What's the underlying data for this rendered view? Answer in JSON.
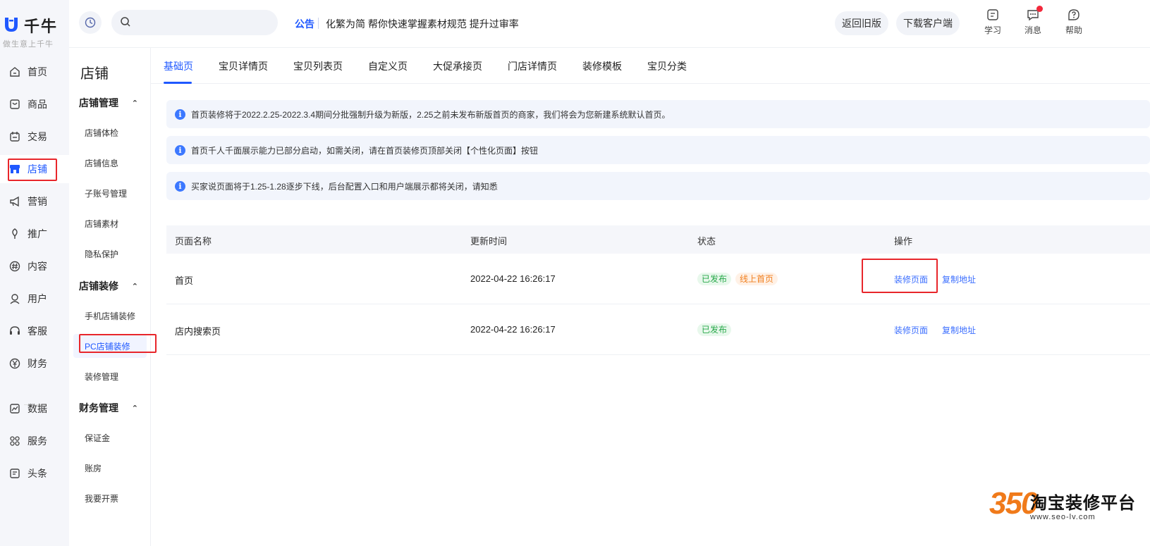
{
  "brand": {
    "name": "千牛",
    "slogan": "做生意上千牛",
    "color": "#1f58ff"
  },
  "leftnav": {
    "items": [
      {
        "label": "首页",
        "icon": "home-icon"
      },
      {
        "label": "商品",
        "icon": "goods-icon"
      },
      {
        "label": "交易",
        "icon": "trade-icon"
      },
      {
        "label": "店铺",
        "icon": "shop-icon",
        "active": true
      },
      {
        "label": "营销",
        "icon": "megaphone-icon"
      },
      {
        "label": "推广",
        "icon": "promote-icon"
      },
      {
        "label": "内容",
        "icon": "hash-icon"
      },
      {
        "label": "用户",
        "icon": "user-icon"
      },
      {
        "label": "客服",
        "icon": "headset-icon"
      },
      {
        "label": "财务",
        "icon": "yen-icon"
      },
      {
        "label": "数据",
        "icon": "chart-icon"
      },
      {
        "label": "服务",
        "icon": "apps-icon"
      },
      {
        "label": "头条",
        "icon": "news-icon"
      }
    ]
  },
  "topbar": {
    "search": {
      "placeholder": "",
      "value": ""
    },
    "notice_tag": "公告",
    "notice_text": "化繁为简 帮你快速掌握素材规范 提升过审率",
    "old_version_label": "返回旧版",
    "download_label": "下载客户端",
    "tools": [
      {
        "label": "学习",
        "icon": "learn-icon"
      },
      {
        "label": "消息",
        "icon": "message-icon",
        "has_unread": true
      },
      {
        "label": "帮助",
        "icon": "help-icon"
      }
    ]
  },
  "subnav": {
    "title": "店铺",
    "groups": [
      {
        "label": "店铺管理",
        "items": [
          "店铺体检",
          "店铺信息",
          "子账号管理",
          "店铺素材",
          "隐私保护"
        ]
      },
      {
        "label": "店铺装修",
        "items": [
          "手机店铺装修",
          "PC店铺装修",
          "装修管理"
        ]
      },
      {
        "label": "财务管理",
        "items": [
          "保证金",
          "账房",
          "我要开票"
        ]
      }
    ],
    "active_item": "PC店铺装修"
  },
  "tabs": [
    "基础页",
    "宝贝详情页",
    "宝贝列表页",
    "自定义页",
    "大促承接页",
    "门店详情页",
    "装修模板",
    "宝贝分类"
  ],
  "notices": [
    "首页装修将于2022.2.25-2022.3.4期间分批强制升级为新版，2.25之前未发布新版首页的商家，我们将会为您新建系统默认首页。",
    "首页千人千面展示能力已部分启动，如需关闭，请在首页装修页顶部关闭【个性化页面】按钮",
    "买家说页面将于1.25-1.28逐步下线，后台配置入口和用户端展示都将关闭，请知悉"
  ],
  "table": {
    "columns": [
      "页面名称",
      "更新时间",
      "状态",
      "操作"
    ],
    "rows": [
      {
        "name": "首页",
        "time": "2022-04-22 16:26:17",
        "status": "已发布",
        "tag": "线上首页",
        "action1": "装修页面",
        "action2": "复制地址"
      },
      {
        "name": "店内搜索页",
        "time": "2022-04-22 16:26:17",
        "status": "已发布",
        "tag": "",
        "action1": "装修页面",
        "action2": "复制地址"
      }
    ]
  },
  "watermark": {
    "number": "350",
    "title": "淘宝装修平台",
    "url": "www.seo-lv.com"
  },
  "colors": {
    "accent": "#1f58ff",
    "highlight_box": "#e8262b",
    "published": "#29a84a",
    "online_tag": "#f08020"
  }
}
